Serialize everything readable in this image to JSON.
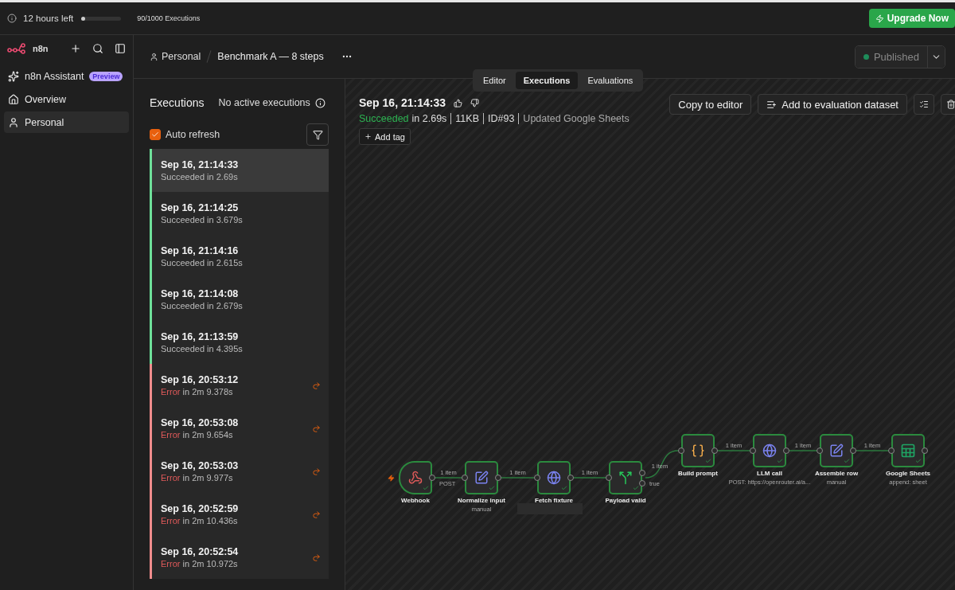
{
  "top_bar": {
    "trial": "12 hours left",
    "usage": {
      "level": 0.09,
      "label": "90/1000 Executions"
    },
    "upgrade": "Upgrade Now"
  },
  "sidebar": {
    "logo": "n8n",
    "items": [
      {
        "label": "n8n Assistant",
        "badge": "Preview",
        "selected": false
      },
      {
        "label": "Overview",
        "selected": false
      },
      {
        "label": "Personal",
        "selected": true
      }
    ]
  },
  "header": {
    "project": "Personal",
    "workflow": "Benchmark A — 8 steps",
    "publish": {
      "label": "Published",
      "published": true
    }
  },
  "tabs": [
    {
      "label": "Editor",
      "selected": false
    },
    {
      "label": "Executions",
      "selected": true
    },
    {
      "label": "Evaluations",
      "selected": false
    }
  ],
  "executions": {
    "title": "Executions",
    "active_note": "No active executions",
    "auto_refresh": {
      "label": "Auto refresh",
      "checked": true
    },
    "items": [
      {
        "time": "Sep 16, 21:14:33",
        "kind": "success",
        "status_label": "Succeeded",
        "duration": "in 2.69s",
        "selected": true
      },
      {
        "time": "Sep 16, 21:14:25",
        "kind": "success",
        "status_label": "Succeeded",
        "duration": "in 3.679s",
        "selected": false
      },
      {
        "time": "Sep 16, 21:14:16",
        "kind": "success",
        "status_label": "Succeeded",
        "duration": "in 2.615s",
        "selected": false
      },
      {
        "time": "Sep 16, 21:14:08",
        "kind": "success",
        "status_label": "Succeeded",
        "duration": "in 2.679s",
        "selected": false
      },
      {
        "time": "Sep 16, 21:13:59",
        "kind": "success",
        "status_label": "Succeeded",
        "duration": "in 4.395s",
        "selected": false
      },
      {
        "time": "Sep 16, 20:53:12",
        "kind": "error",
        "status_label": "Error",
        "duration": "in 2m 9.378s",
        "selected": false
      },
      {
        "time": "Sep 16, 20:53:08",
        "kind": "error",
        "status_label": "Error",
        "duration": "in 2m 9.654s",
        "selected": false
      },
      {
        "time": "Sep 16, 20:53:03",
        "kind": "error",
        "status_label": "Error",
        "duration": "in 2m 9.977s",
        "selected": false
      },
      {
        "time": "Sep 16, 20:52:59",
        "kind": "error",
        "status_label": "Error",
        "duration": "in 2m 10.436s",
        "selected": false
      },
      {
        "time": "Sep 16, 20:52:54",
        "kind": "error",
        "status_label": "Error",
        "duration": "in 2m 10.972s",
        "selected": false
      }
    ]
  },
  "detail": {
    "title": "Sep 16, 21:14:33",
    "kind": "success",
    "status_label": "Succeeded",
    "duration": "in 2.69s",
    "size": "11KB",
    "id": "ID#93",
    "workflow": "Updated Google Sheets",
    "add_tag": "Add tag",
    "buttons": [
      "Copy to editor",
      "Add to evaluation dataset"
    ]
  },
  "canvas": {
    "nodes": [
      {
        "label": "Webhook",
        "kind": "webhook",
        "trigger": true,
        "output_label": "POST"
      },
      {
        "label": "Normalize input",
        "kind": "edit",
        "subtitle": "manual"
      },
      {
        "label": "Fetch fixture",
        "kind": "http"
      },
      {
        "label": "Payload valid",
        "kind": "if",
        "output_label": "true"
      },
      {
        "label": "Build prompt",
        "kind": "code"
      },
      {
        "label": "LLM call",
        "kind": "http",
        "subtitle": "POST: https://openrouter.ai/a..."
      },
      {
        "label": "Assemble row",
        "kind": "edit",
        "subtitle": "manual"
      },
      {
        "label": "Google Sheets",
        "kind": "sheets",
        "subtitle": "append: sheet"
      }
    ],
    "edges": [
      "1 item",
      "1 item",
      "1 item",
      "1 item",
      "1 item",
      "1 item",
      "1 item"
    ]
  }
}
